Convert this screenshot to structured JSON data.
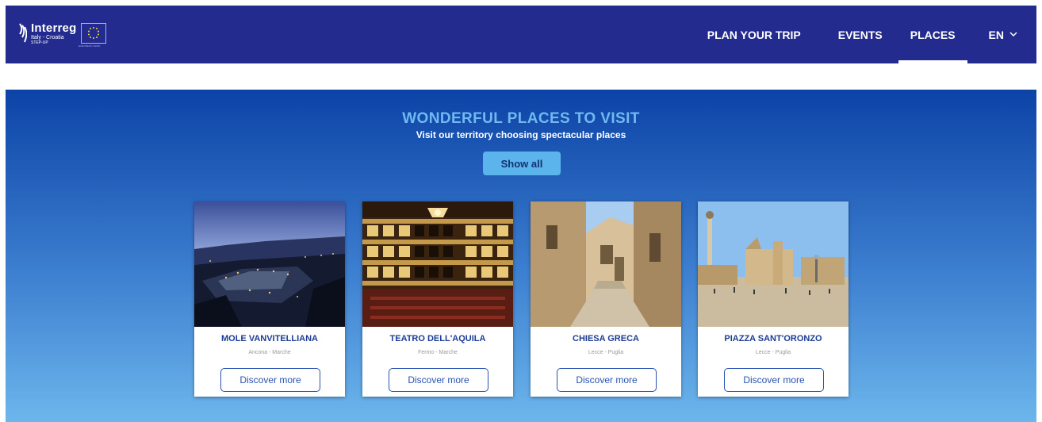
{
  "brand": {
    "name": "Interreg",
    "region": "Italy - Croatia",
    "project": "STEP-UP",
    "eu_caption": "EUROPEAN UNION",
    "logo_icon": "interreg-logo-icon",
    "flag_icon": "eu-flag-icon"
  },
  "nav": {
    "items": [
      {
        "label": "PLAN YOUR TRIP",
        "active": false
      },
      {
        "label": "EVENTS",
        "active": false
      },
      {
        "label": "PLACES",
        "active": true
      }
    ],
    "language": "EN",
    "language_icon": "chevron-down-icon"
  },
  "hero": {
    "title": "WONDERFUL PLACES TO VISIT",
    "subtitle": "Visit our territory choosing spectacular places",
    "show_all_label": "Show all"
  },
  "places": [
    {
      "title": "MOLE VANVITELLIANA",
      "location": "Ancona - Marche",
      "button": "Discover more"
    },
    {
      "title": "TEATRO DELL'AQUILA",
      "location": "Fermo - Marche",
      "button": "Discover more"
    },
    {
      "title": "CHIESA GRECA",
      "location": "Lecce - Puglia",
      "button": "Discover more"
    },
    {
      "title": "PIAZZA SANT'ORONZO",
      "location": "Lecce - Puglia",
      "button": "Discover more"
    }
  ],
  "colors": {
    "navbar": "#232c8e",
    "hero_top": "#0c43a6",
    "hero_bottom": "#6cb6ec",
    "accent": "#5bb4ec",
    "card_title": "#1d3c95"
  }
}
